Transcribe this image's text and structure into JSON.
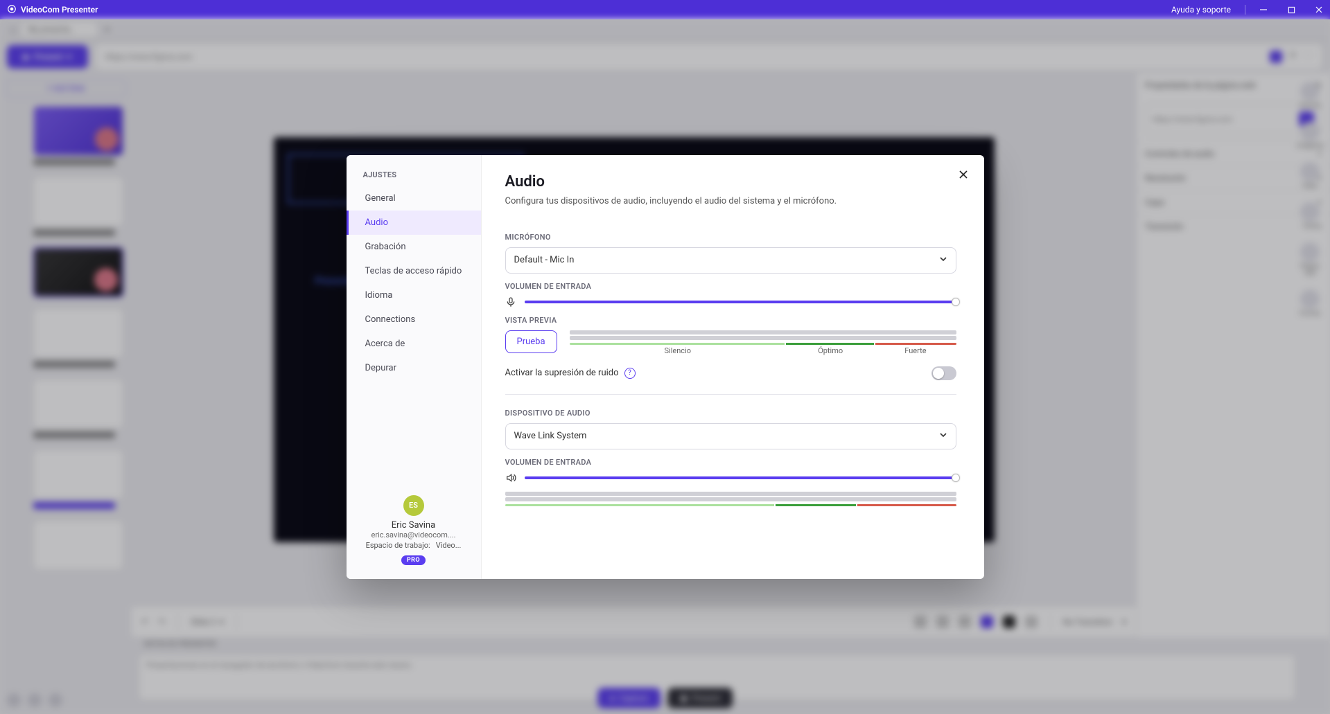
{
  "titlebar": {
    "app_name": "VideoCom Presenter",
    "help": "Ayuda y soporte"
  },
  "bg": {
    "tab_name": "My presenta...",
    "present_btn": "Present",
    "url": "https://www.figma.com",
    "add_slide": "Add Slide",
    "right_header": "Propiedades de la página web",
    "right_url": "https://www.figma.com",
    "acc": {
      "audio": "Controles de audio",
      "resolution": "Resolución",
      "layer": "Capa",
      "transition": "Transición"
    },
    "right_icons": {
      "general": "General",
      "images": "Imágenes",
      "video": "Video",
      "text": "Texto",
      "web": "Página web",
      "shapes": "Formas"
    },
    "notes_label": "NOTAS DE PRESENTER",
    "notes_placeholder": "Presentaciones en el navegador de escritorio o VideoCom durante este verano.",
    "bb_capture": "Capture",
    "bb_present": "Present",
    "toolbar_slide": "Slide 3",
    "toolbar_trans": "No Transition",
    "stage_text": "Presentación de producto"
  },
  "modal": {
    "side_header": "AJUSTES",
    "items": {
      "general": "General",
      "audio": "Audio",
      "recording": "Grabación",
      "hotkeys": "Teclas de acceso rápido",
      "language": "Idioma",
      "connections": "Connections",
      "about": "Acerca de",
      "debug": "Depurar"
    },
    "user": {
      "initials": "ES",
      "name": "Eric Savina",
      "email": "eric.savina@videocom....",
      "ws_label": "Espacio de trabajo:",
      "ws_value": "Video...",
      "badge": "PRO"
    },
    "title": "Audio",
    "subtitle": "Configura tus dispositivos de audio, incluyendo el audio del sistema y el micrófono.",
    "mic": {
      "label": "MICRÓFONO",
      "value": "Default - Mic In",
      "vol_label": "VOLUMEN DE ENTRADA",
      "preview_label": "VISTA PREVIA",
      "test_btn": "Prueba",
      "scale_silence": "Silencio",
      "scale_optimal": "Óptimo",
      "scale_loud": "Fuerte",
      "noise_label": "Activar la supresión de ruido"
    },
    "out": {
      "label": "DISPOSITIVO DE AUDIO",
      "value": "Wave Link System",
      "vol_label": "VOLUMEN DE ENTRADA"
    }
  }
}
